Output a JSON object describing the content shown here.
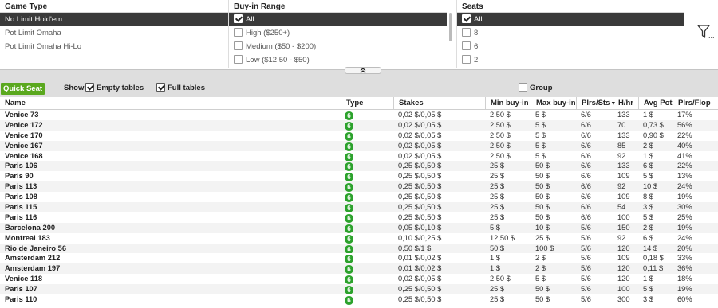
{
  "filters": {
    "game_type": {
      "title": "Game Type",
      "items": [
        {
          "label": "No Limit Hold'em",
          "selected": true
        },
        {
          "label": "Pot Limit Omaha",
          "selected": false
        },
        {
          "label": "Pot Limit Omaha Hi-Lo",
          "selected": false
        }
      ]
    },
    "buy_in": {
      "title": "Buy-in Range",
      "items": [
        {
          "label": "All",
          "checked": true,
          "selected": true
        },
        {
          "label": "High ($250+)",
          "checked": false
        },
        {
          "label": "Medium ($50 - $200)",
          "checked": false
        },
        {
          "label": "Low ($12.50 - $50)",
          "checked": false
        }
      ]
    },
    "seats": {
      "title": "Seats",
      "items": [
        {
          "label": "All",
          "checked": true,
          "selected": true
        },
        {
          "label": "8",
          "checked": false
        },
        {
          "label": "6",
          "checked": false
        },
        {
          "label": "2",
          "checked": false
        }
      ]
    },
    "filter_icon_label": "..."
  },
  "toolbar": {
    "quick_seat": "Quick Seat",
    "show_label": "Show:",
    "empty_tables": {
      "label": "Empty tables",
      "checked": true
    },
    "full_tables": {
      "label": "Full tables",
      "checked": true
    },
    "group": {
      "label": "Group",
      "checked": false
    }
  },
  "table": {
    "columns": [
      "Name",
      "Type",
      "Stakes",
      "Min buy-in",
      "Max buy-in",
      "Plrs/Sts",
      "H/hr",
      "Avg Pot",
      "Plrs/Flop"
    ],
    "sorted_column": "Plrs/Sts",
    "rows": [
      [
        "Venice 73",
        "6",
        "0,02 $/0,05 $",
        "2,50 $",
        "5 $",
        "6/6",
        "133",
        "1 $",
        "17%"
      ],
      [
        "Venice 172",
        "6",
        "0,02 $/0,05 $",
        "2,50 $",
        "5 $",
        "6/6",
        "70",
        "0,73 $",
        "56%"
      ],
      [
        "Venice 170",
        "6",
        "0,02 $/0,05 $",
        "2,50 $",
        "5 $",
        "6/6",
        "133",
        "0,90 $",
        "22%"
      ],
      [
        "Venice 167",
        "6",
        "0,02 $/0,05 $",
        "2,50 $",
        "5 $",
        "6/6",
        "85",
        "2 $",
        "40%"
      ],
      [
        "Venice 168",
        "6",
        "0,02 $/0,05 $",
        "2,50 $",
        "5 $",
        "6/6",
        "92",
        "1 $",
        "41%"
      ],
      [
        "Paris 106",
        "6",
        "0,25 $/0,50 $",
        "25 $",
        "50 $",
        "6/6",
        "133",
        "6 $",
        "22%"
      ],
      [
        "Paris 90",
        "6",
        "0,25 $/0,50 $",
        "25 $",
        "50 $",
        "6/6",
        "109",
        "5 $",
        "13%"
      ],
      [
        "Paris 113",
        "6",
        "0,25 $/0,50 $",
        "25 $",
        "50 $",
        "6/6",
        "92",
        "10 $",
        "24%"
      ],
      [
        "Paris 108",
        "6",
        "0,25 $/0,50 $",
        "25 $",
        "50 $",
        "6/6",
        "109",
        "8 $",
        "19%"
      ],
      [
        "Paris 115",
        "6",
        "0,25 $/0,50 $",
        "25 $",
        "50 $",
        "6/6",
        "54",
        "3 $",
        "30%"
      ],
      [
        "Paris 116",
        "6",
        "0,25 $/0,50 $",
        "25 $",
        "50 $",
        "6/6",
        "100",
        "5 $",
        "25%"
      ],
      [
        "Barcelona 200",
        "6",
        "0,05 $/0,10 $",
        "5 $",
        "10 $",
        "5/6",
        "150",
        "2 $",
        "19%"
      ],
      [
        "Montreal 183",
        "6",
        "0,10 $/0,25 $",
        "12,50 $",
        "25 $",
        "5/6",
        "92",
        "6 $",
        "24%"
      ],
      [
        "Rio de Janeiro 56",
        "6",
        "0,50 $/1 $",
        "50 $",
        "100 $",
        "5/6",
        "120",
        "14 $",
        "20%"
      ],
      [
        "Amsterdam 212",
        "6",
        "0,01 $/0,02 $",
        "1 $",
        "2 $",
        "5/6",
        "109",
        "0,18 $",
        "33%"
      ],
      [
        "Amsterdam 197",
        "6",
        "0,01 $/0,02 $",
        "1 $",
        "2 $",
        "5/6",
        "120",
        "0,11 $",
        "36%"
      ],
      [
        "Venice 118",
        "6",
        "0,02 $/0,05 $",
        "2,50 $",
        "5 $",
        "5/6",
        "120",
        "1 $",
        "18%"
      ],
      [
        "Paris 107",
        "6",
        "0,25 $/0,50 $",
        "25 $",
        "50 $",
        "5/6",
        "100",
        "5 $",
        "19%"
      ],
      [
        "Paris 110",
        "6",
        "0,25 $/0,50 $",
        "25 $",
        "50 $",
        "5/6",
        "300",
        "3 $",
        "60%"
      ]
    ]
  }
}
